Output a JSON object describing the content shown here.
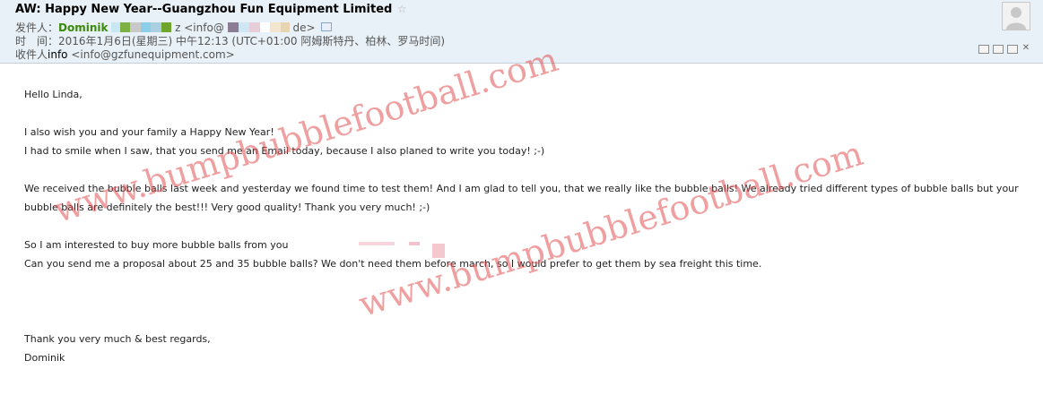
{
  "email": {
    "subject": "AW: Happy New Year--Guangzhou Fun Equipment Limited",
    "star_icon": "☆",
    "from_label": "发件人：",
    "from_name": "Dominik",
    "from_address_start": "z <info@",
    "from_address_end": "de>",
    "time_label": "时　间：",
    "time_value": "2016年1月6日(星期三) 中午12:13 (UTC+01:00 阿姆斯特丹、柏林、罗马时间)",
    "to_label": "收件人",
    "to_name": "info",
    "to_address": "<info@gzfunequipment.com>"
  },
  "body": {
    "greeting": "Hello Linda,",
    "line1": "I also wish you and your family a Happy New Year!",
    "line2": "I had to smile when I saw, that you send me an Email today, because I also planed to write you today! ;-)",
    "para2": "We received the bubble balls last week and yesterday we found time to test them! And I am glad to tell you, that we really like the bubble balls! We already tried different types of bubble balls but your bubble balls are definitely the best!!! Very good quality! Thank you very much! ;-)",
    "line3": "So I am interested to buy more bubble balls from you",
    "line4": "Can you send me a proposal about 25 and 35 bubble balls? We don't need them before march, so I would prefer to get them by sea freight this time.",
    "closing": "Thank you very much & best regards,",
    "signature": "Dominik"
  },
  "watermark": {
    "text1": "www.bumpbubblefootball.com",
    "text2": "www.bumpbubblefootball.com"
  },
  "icons": {
    "avatar": "avatar-icon",
    "star": "star-icon",
    "vcard": "contact-card-icon",
    "window_tools": [
      "restore-icon",
      "maximize-icon",
      "new-window-icon",
      "close-icon"
    ]
  },
  "colors": {
    "header_bg": "#e8f0f8",
    "sender_name": "#3a8a0a",
    "watermark": "#e25050"
  }
}
